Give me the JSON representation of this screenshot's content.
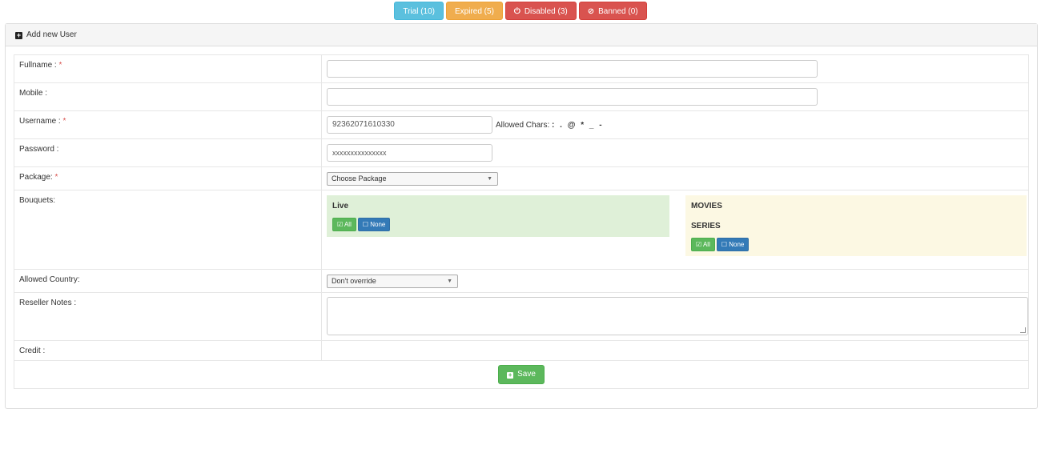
{
  "filters": {
    "trial": "Trial (10)",
    "expired": "Expired (5)",
    "disabled": "Disabled (3)",
    "banned": "Banned (0)"
  },
  "panel": {
    "title": "Add new User"
  },
  "form": {
    "fullname": {
      "label": "Fullname :",
      "req": "*",
      "value": ""
    },
    "mobile": {
      "label": "Mobile :",
      "value": ""
    },
    "username": {
      "label": "Username :",
      "req": "*",
      "value": "92362071610330",
      "allowed_label": "Allowed Chars:",
      "allowed_chars": ": . @ * _ -"
    },
    "password": {
      "label": "Password :",
      "value": "xxxxxxxxxxxxxxx"
    },
    "package": {
      "label": "Package:",
      "req": "*",
      "selected": "Choose Package"
    },
    "bouquets": {
      "label": "Bouquets:",
      "groups": [
        {
          "title": "Live",
          "all": "All",
          "none": "None"
        },
        {
          "title": "MOVIES",
          "subtitle": "SERIES",
          "all": "All",
          "none": "None"
        }
      ]
    },
    "country": {
      "label": "Allowed Country:",
      "selected": "Don't override"
    },
    "notes": {
      "label": "Reseller Notes :",
      "value": ""
    },
    "credit": {
      "label": "Credit :",
      "value": ""
    },
    "save_label": "Save"
  },
  "colors": {
    "info": "#5bc0de",
    "warning": "#f0ad4e",
    "danger": "#d9534f",
    "success": "#5cb85c",
    "primary": "#337ab7"
  }
}
